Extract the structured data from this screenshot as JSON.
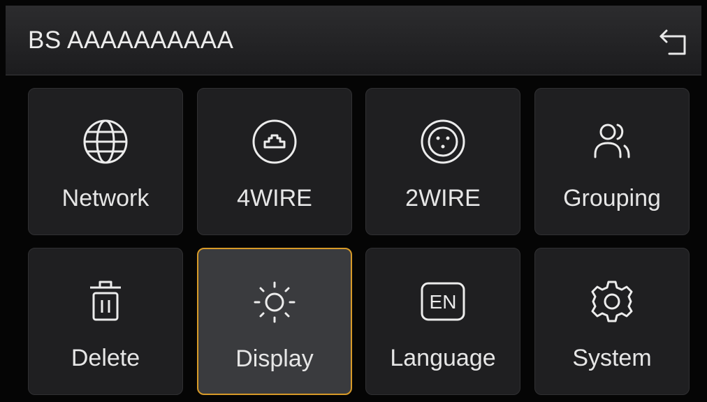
{
  "header": {
    "title": "BS AAAAAAAAAA",
    "back_icon": "return-arrow-icon"
  },
  "tiles": [
    {
      "label": "Network",
      "icon": "globe-icon",
      "selected": false
    },
    {
      "label": "4WIRE",
      "icon": "ethernet-port-icon",
      "selected": false
    },
    {
      "label": "2WIRE",
      "icon": "xlr-connector-icon",
      "selected": false
    },
    {
      "label": "Grouping",
      "icon": "users-icon",
      "selected": false
    },
    {
      "label": "Delete",
      "icon": "trash-icon",
      "selected": false
    },
    {
      "label": "Display",
      "icon": "brightness-icon",
      "selected": true
    },
    {
      "label": "Language",
      "icon": "language-en-icon",
      "badge": "EN",
      "selected": false
    },
    {
      "label": "System",
      "icon": "gear-icon",
      "selected": false
    }
  ],
  "colors": {
    "background": "#050505",
    "tile": "#1f1f21",
    "tile_selected": "#3a3b3e",
    "accent_border": "#d79a28",
    "text": "#e6e6e6"
  }
}
